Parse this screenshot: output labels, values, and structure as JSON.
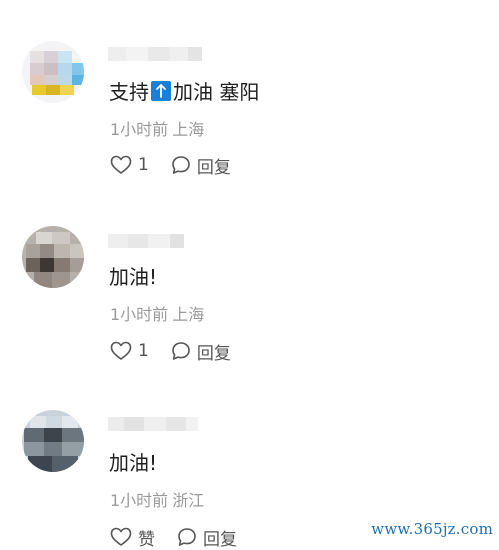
{
  "comments": [
    {
      "content_before": "支持",
      "emoji_icon": "up-arrow-button-icon",
      "content_after": "加油 塞阳",
      "time": "1小时前",
      "location": "上海",
      "like_label": "1",
      "reply_label": "回复"
    },
    {
      "content_before": "加油!",
      "content_after": "",
      "time": "1小时前",
      "location": "上海",
      "like_label": "1",
      "reply_label": "回复"
    },
    {
      "content_before": "加油!",
      "content_after": "",
      "time": "1小时前",
      "location": "浙江",
      "like_label": "赞",
      "reply_label": "回复"
    }
  ],
  "watermark": "www.365jz.com",
  "colors": {
    "accent_blue": "#1a7fd6",
    "meta_gray": "#9a9a9a",
    "action_gray": "#555555",
    "watermark_blue": "#1f6fb0"
  }
}
